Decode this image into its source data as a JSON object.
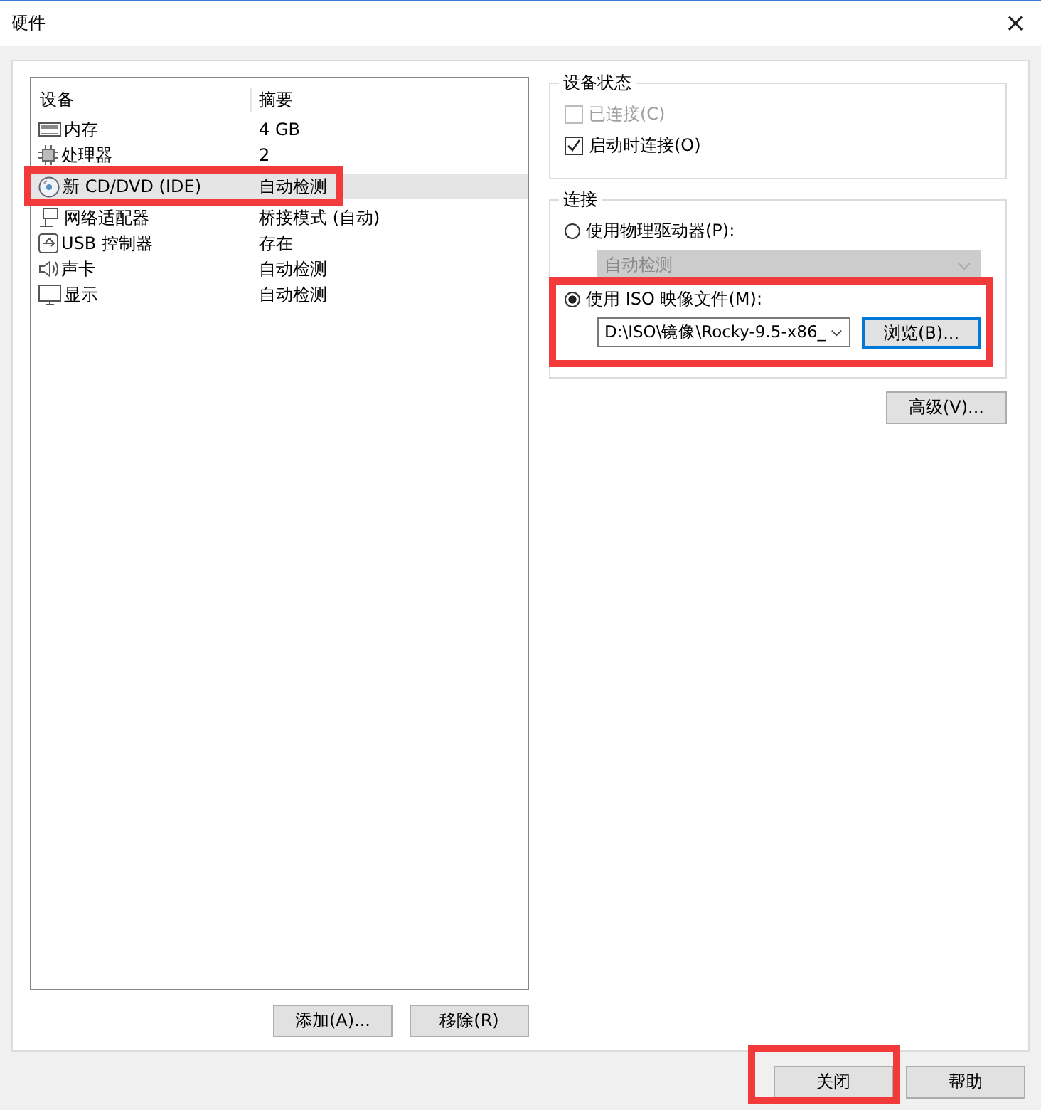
{
  "window": {
    "title": "硬件",
    "close": "×"
  },
  "device_table": {
    "columns": [
      "设备",
      "摘要"
    ],
    "rows": [
      {
        "kind": "memory",
        "device": "内存",
        "summary": "4 GB",
        "selected": false,
        "highlighted": false
      },
      {
        "kind": "cpu",
        "device": "处理器",
        "summary": "2",
        "selected": false,
        "highlighted": false
      },
      {
        "kind": "disc",
        "device": "新 CD/DVD (IDE)",
        "summary": "自动检测",
        "selected": true,
        "highlighted": true
      },
      {
        "kind": "network",
        "device": "网络适配器",
        "summary": "桥接模式 (自动)",
        "selected": false,
        "highlighted": false
      },
      {
        "kind": "usb",
        "device": "USB 控制器",
        "summary": "存在",
        "selected": false,
        "highlighted": false
      },
      {
        "kind": "sound",
        "device": "声卡",
        "summary": "自动检测",
        "selected": false,
        "highlighted": false
      },
      {
        "kind": "display",
        "device": "显示",
        "summary": "自动检测",
        "selected": false,
        "highlighted": false
      }
    ]
  },
  "list_buttons": [
    "添加(A)...",
    "移除(R)"
  ],
  "device_status": {
    "title": "设备状态",
    "options": [
      {
        "label": "已连接(C)",
        "checked": false,
        "disabled": true
      },
      {
        "label": "启动时连接(O)",
        "checked": true,
        "disabled": false
      }
    ]
  },
  "connection": {
    "title": "连接",
    "physical": {
      "label": "使用物理驱动器(P):",
      "selected": false,
      "dropdown": "自动检测",
      "disabled": true
    },
    "iso": {
      "label": "使用 ISO 映像文件(M):",
      "selected": true,
      "value": "D:\\ISO\\镜像\\Rocky-9.5-x86_",
      "browse": "浏览(B)...",
      "highlighted": true
    }
  },
  "advanced_button": "高级(V)...",
  "footer_buttons": [
    {
      "label": "关闭",
      "highlighted": true
    },
    {
      "label": "帮助",
      "highlighted": false
    }
  ]
}
